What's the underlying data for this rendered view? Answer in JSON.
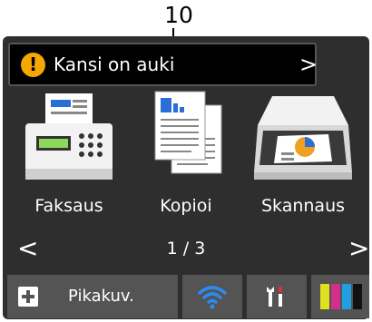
{
  "callout": {
    "number": "10"
  },
  "alert": {
    "text": "Kansi on auki",
    "icon": "warning-icon",
    "color": "#f5a800"
  },
  "apps": [
    {
      "label": "Faksaus",
      "icon": "fax-icon"
    },
    {
      "label": "Kopioi",
      "icon": "copy-icon"
    },
    {
      "label": "Skannaus",
      "icon": "scan-icon"
    }
  ],
  "pager": {
    "text": "1 / 3"
  },
  "bottom_bar": {
    "shortcut_label": "Pikakuv.",
    "shortcut_icon": "plus-icon",
    "wifi_icon": "wifi-icon",
    "wifi_color": "#2a8cf0",
    "settings_icon": "tools-icon",
    "ink_icon": "ink-level-icon"
  }
}
